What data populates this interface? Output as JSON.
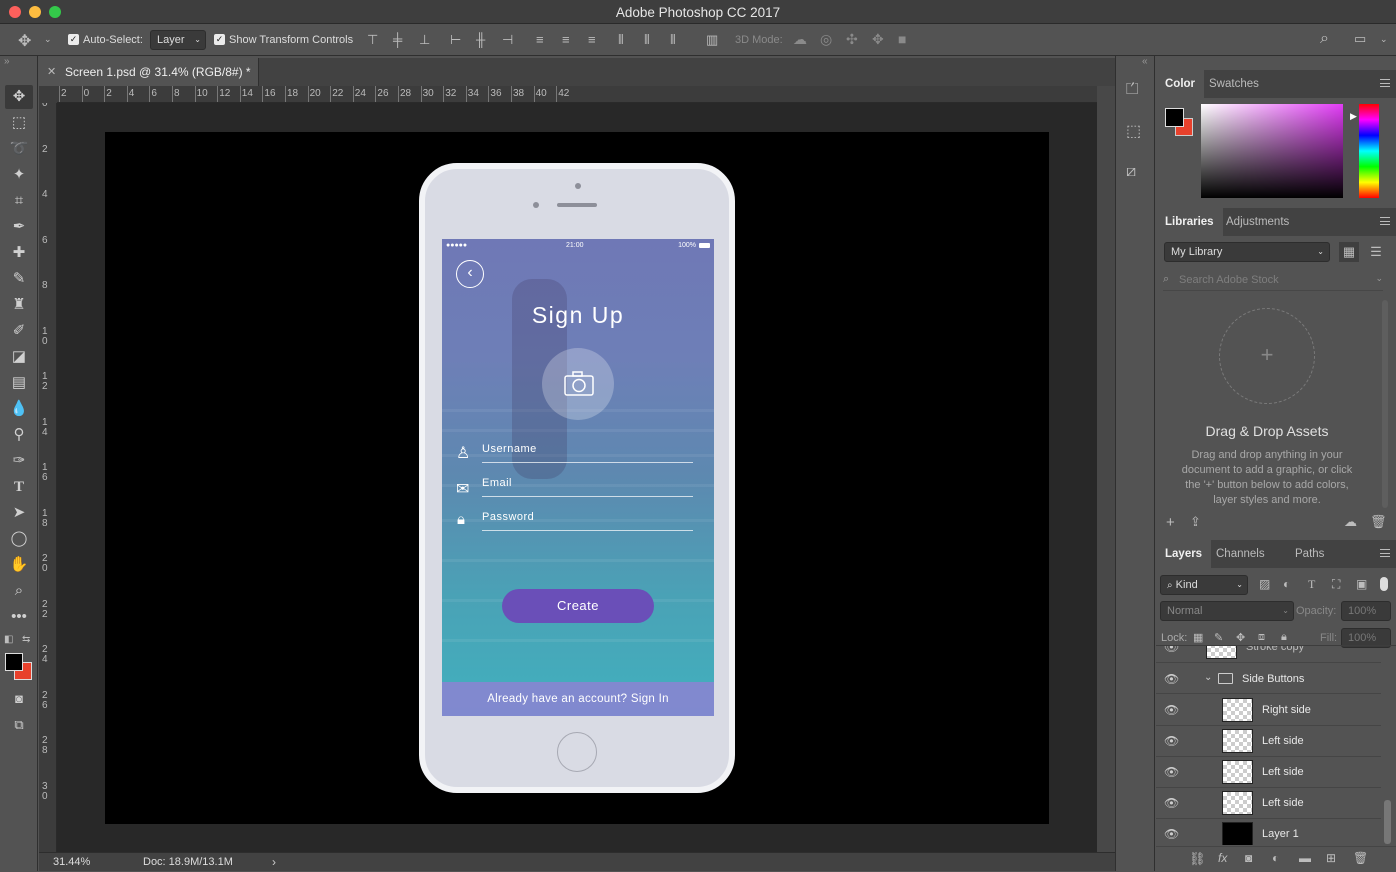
{
  "window": {
    "title": "Adobe Photoshop CC 2017"
  },
  "options_bar": {
    "auto_select_label": "Auto-Select:",
    "auto_select_value": "Layer",
    "transform_label": "Show Transform Controls",
    "mode_3d_label": "3D Mode:"
  },
  "document": {
    "tab_title": "Screen 1.psd @ 31.4% (RGB/8#) *",
    "zoom": "31.44%",
    "doc_info": "Doc: 18.9M/13.1M"
  },
  "ruler": {
    "h_ticks": [
      "2",
      "0",
      "2",
      "4",
      "6",
      "8",
      "10",
      "12",
      "14",
      "16",
      "18",
      "20",
      "22",
      "24",
      "26",
      "28",
      "30",
      "32",
      "34",
      "36",
      "38",
      "40",
      "42"
    ],
    "v_ticks": [
      "0",
      "2",
      "4",
      "6",
      "8",
      "1 0",
      "1 2",
      "1 4",
      "1 6",
      "1 8",
      "2 0",
      "2 2",
      "2 4",
      "2 6",
      "2 8",
      "3 0"
    ]
  },
  "mockup": {
    "status_left": "●●●●● ",
    "status_time": "21:00",
    "status_right": "100%",
    "title": "Sign Up",
    "username_placeholder": "Username",
    "email_placeholder": "Email",
    "password_placeholder": "Password",
    "create_label": "Create",
    "signin_text": "Already have an account? Sign In"
  },
  "color_panel": {
    "tabs": [
      "Color",
      "Swatches"
    ],
    "foreground": "#000000",
    "background": "#e8412c"
  },
  "libraries_panel": {
    "tabs": [
      "Libraries",
      "Adjustments"
    ],
    "library": "My Library",
    "search_placeholder": "Search Adobe Stock",
    "dnd_title": "Drag & Drop Assets",
    "dnd_body": "Drag and drop anything in your document to add a graphic, or click the '+' button below to add colors, layer styles and more."
  },
  "layers_panel": {
    "tabs": [
      "Layers",
      "Channels",
      "Paths"
    ],
    "filter": "Kind",
    "blend_mode": "Normal",
    "opacity_label": "Opacity:",
    "opacity_value": "100%",
    "lock_label": "Lock:",
    "fill_label": "Fill:",
    "fill_value": "100%",
    "partial_layer": "Stroke copy",
    "group_name": "Side Buttons",
    "layers": [
      {
        "name": "Right side",
        "thumb": "transparent"
      },
      {
        "name": "Left side",
        "thumb": "transparent"
      },
      {
        "name": "Left side",
        "thumb": "transparent"
      },
      {
        "name": "Left side",
        "thumb": "transparent"
      },
      {
        "name": "Layer 1",
        "thumb": "black"
      }
    ]
  },
  "colors": {
    "accent_button": "#6a4fb8",
    "ui_bg": "#535353"
  }
}
